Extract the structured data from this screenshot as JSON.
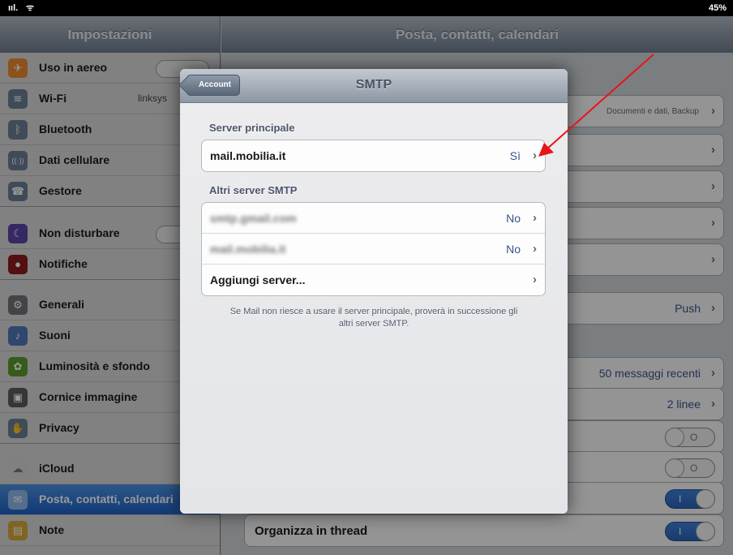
{
  "status_bar": {
    "signal": "ııl.",
    "wifi": "ᯤ",
    "battery": "45%"
  },
  "sidebar": {
    "title": "Impostazioni",
    "items": [
      {
        "label": "Uso in aereo",
        "icon": "airplane-icon",
        "color": "#e9892e",
        "glyph": "✈"
      },
      {
        "label": "Wi-Fi",
        "value": "linksys",
        "icon": "wifi-icon",
        "color": "#6b7d94",
        "glyph": "≋"
      },
      {
        "label": "Bluetooth",
        "icon": "bluetooth-icon",
        "color": "#6b7d94",
        "glyph": "ᛒ"
      },
      {
        "label": "Dati cellulare",
        "icon": "cellular-icon",
        "color": "#6b7d94",
        "glyph": "((·))"
      },
      {
        "label": "Gestore",
        "icon": "phone-icon",
        "color": "#6b7d94",
        "glyph": "☎"
      },
      {
        "label": "Non disturbare",
        "icon": "moon-icon",
        "color": "#5b43a5",
        "glyph": "☾"
      },
      {
        "label": "Notifiche",
        "icon": "notifications-icon",
        "color": "#8b1c1c",
        "glyph": "●"
      },
      {
        "label": "Generali",
        "icon": "gear-icon",
        "color": "#6e7278",
        "glyph": "⚙"
      },
      {
        "label": "Suoni",
        "icon": "speaker-icon",
        "color": "#4f77b8",
        "glyph": "♪"
      },
      {
        "label": "Luminosità e sfondo",
        "icon": "flower-icon",
        "color": "#5b9a2f",
        "glyph": "✿"
      },
      {
        "label": "Cornice immagine",
        "icon": "picture-frame-icon",
        "color": "#5a5a5a",
        "glyph": "▣"
      },
      {
        "label": "Privacy",
        "icon": "hand-icon",
        "color": "#6b7d94",
        "glyph": "✋"
      },
      {
        "label": "iCloud",
        "icon": "cloud-icon",
        "color": "#d6d6d6",
        "glyph": "☁"
      },
      {
        "label": "Posta, contatti, calendari",
        "icon": "mail-icon",
        "color": "#3d7ed8",
        "glyph": "✉"
      },
      {
        "label": "Note",
        "icon": "notes-icon",
        "color": "#d4a73a",
        "glyph": "▤"
      }
    ]
  },
  "main": {
    "title": "Posta, contatti, calendari",
    "rows": {
      "icloud_value": "Documenti e dati, Backup",
      "push": "Push",
      "mostra": "50 messaggi recenti",
      "anteprima": "2 linee",
      "organizza": "Organizza in thread"
    },
    "toggle_on": "I",
    "toggle_off": "O"
  },
  "modal": {
    "title": "SMTP",
    "back_label": "Account",
    "primary_section": "Server principale",
    "primary": {
      "server": "mail.mobilia.it",
      "value": "Sì"
    },
    "other_section": "Altri server SMTP",
    "others": [
      {
        "server": "smtp.gmail.com",
        "value": "No"
      },
      {
        "server": "mail.mobilia.it",
        "value": "No"
      }
    ],
    "add_label": "Aggiungi server...",
    "note": "Se Mail non riesce a usare il server principale, proverà in successione gli altri server SMTP.",
    "chevron": "›"
  },
  "annotation": {
    "arrow_color": "#e8141a"
  }
}
